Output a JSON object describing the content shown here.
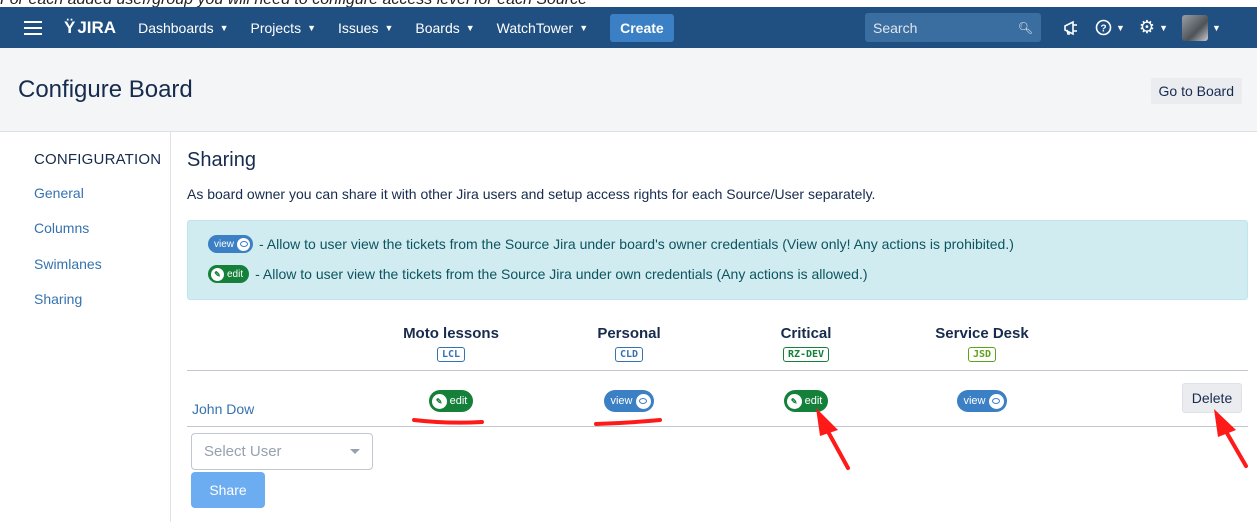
{
  "caption": "For each added user/group you will need to configure access level for each Source",
  "navbar": {
    "logo": "JIRA",
    "items": [
      {
        "label": "Dashboards"
      },
      {
        "label": "Projects"
      },
      {
        "label": "Issues"
      },
      {
        "label": "Boards"
      },
      {
        "label": "WatchTower"
      }
    ],
    "create_label": "Create",
    "search_placeholder": "Search",
    "icons": [
      "megaphone-icon",
      "help-icon",
      "gear-icon",
      "avatar"
    ]
  },
  "header": {
    "title": "Configure Board",
    "goto_board_label": "Go to Board"
  },
  "sidebar": {
    "heading": "CONFIGURATION",
    "items": [
      {
        "label": "General"
      },
      {
        "label": "Columns"
      },
      {
        "label": "Swimlanes"
      },
      {
        "label": "Sharing"
      }
    ]
  },
  "main": {
    "title": "Sharing",
    "description": "As board owner you can share it with other Jira users and setup access rights for each Source/User separately.",
    "info": {
      "view_pill": "view",
      "view_text": "- Allow to user view the tickets from the Source Jira under board's owner credentials (View only! Any actions is prohibited.)",
      "edit_pill": "edit",
      "edit_text": "- Allow to user view the tickets from the Source Jira under own credentials (Any actions is allowed.)"
    },
    "columns": [
      {
        "name": "Moto lessons",
        "key": "LCL",
        "key_color": "#3572b0"
      },
      {
        "name": "Personal",
        "key": "CLD",
        "key_color": "#3572b0"
      },
      {
        "name": "Critical",
        "key": "RZ-DEV",
        "key_color": "#14803a"
      },
      {
        "name": "Service Desk",
        "key": "JSD",
        "key_color": "#5ea11a"
      }
    ],
    "rows": [
      {
        "user": "John Dow",
        "access": [
          "edit",
          "view",
          "edit",
          "view"
        ],
        "delete_label": "Delete"
      }
    ],
    "select_placeholder": "Select User",
    "share_label": "Share"
  },
  "colors": {
    "navbar": "#205081",
    "view": "#3b7fc4",
    "edit": "#14803a",
    "annotation": "#ff1a1a"
  }
}
